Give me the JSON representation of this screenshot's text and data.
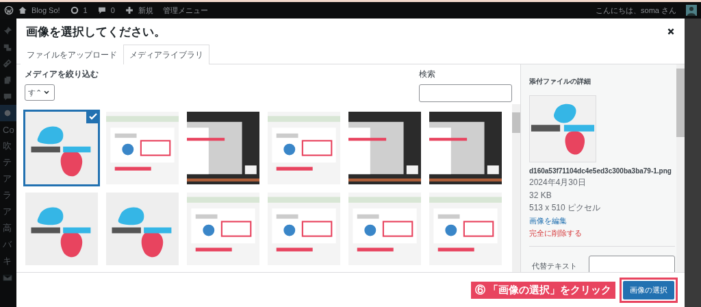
{
  "admin_bar": {
    "site": "Blog So!",
    "updates": "1",
    "comments": "0",
    "new": "新規",
    "menu": "管理メニュー",
    "greeting": "こんにちは、soma さん"
  },
  "admin_sidebar": [
    {
      "kind": "icon"
    },
    {
      "kind": "icon"
    },
    {
      "kind": "icon"
    },
    {
      "kind": "icon"
    },
    {
      "kind": "icon"
    },
    {
      "kind": "icon",
      "selected": true
    },
    {
      "kind": "text",
      "label": "Co"
    },
    {
      "kind": "text",
      "label": "吹"
    },
    {
      "kind": "text",
      "label": "テ"
    },
    {
      "kind": "text",
      "label": "ア"
    },
    {
      "kind": "text",
      "label": "ラ"
    },
    {
      "kind": "text",
      "label": "ア"
    },
    {
      "kind": "text",
      "label": "高"
    },
    {
      "kind": "text",
      "label": "バ"
    },
    {
      "kind": "text",
      "label": "キ"
    },
    {
      "kind": "icon"
    }
  ],
  "dialog": {
    "title": "画像を選択してください。",
    "tabs": [
      {
        "label": "ファイルをアップロード",
        "selected": false
      },
      {
        "label": "メディアライブラリ",
        "selected": true
      }
    ],
    "filter": {
      "label": "メディアを絞り込む",
      "value": "す⌃"
    },
    "search": {
      "label": "検索"
    },
    "thumbnails": [
      {
        "kind": "logo",
        "selected": true
      },
      {
        "kind": "light",
        "selected": false
      },
      {
        "kind": "dark",
        "selected": false
      },
      {
        "kind": "light",
        "selected": false
      },
      {
        "kind": "dark",
        "selected": false
      },
      {
        "kind": "dark",
        "selected": false
      },
      {
        "kind": "logo",
        "selected": false
      },
      {
        "kind": "logo",
        "selected": false
      },
      {
        "kind": "light",
        "selected": false
      },
      {
        "kind": "light",
        "selected": false
      },
      {
        "kind": "light",
        "selected": false
      },
      {
        "kind": "light",
        "selected": false
      }
    ],
    "details": {
      "heading": "添付ファイルの詳細",
      "filename": "d160a53f71104dc4e5ed3c300ba3ba79-1.png",
      "date": "2024年4月30日",
      "size": "32 KB",
      "dimensions": "513 x 510 ピクセル",
      "edit_link": "画像を編集",
      "delete_link": "完全に削除する",
      "alt_label": "代替テキスト"
    },
    "annotation": "⑥ 「画像の選択」をクリック",
    "select_button": "画像の選択"
  }
}
